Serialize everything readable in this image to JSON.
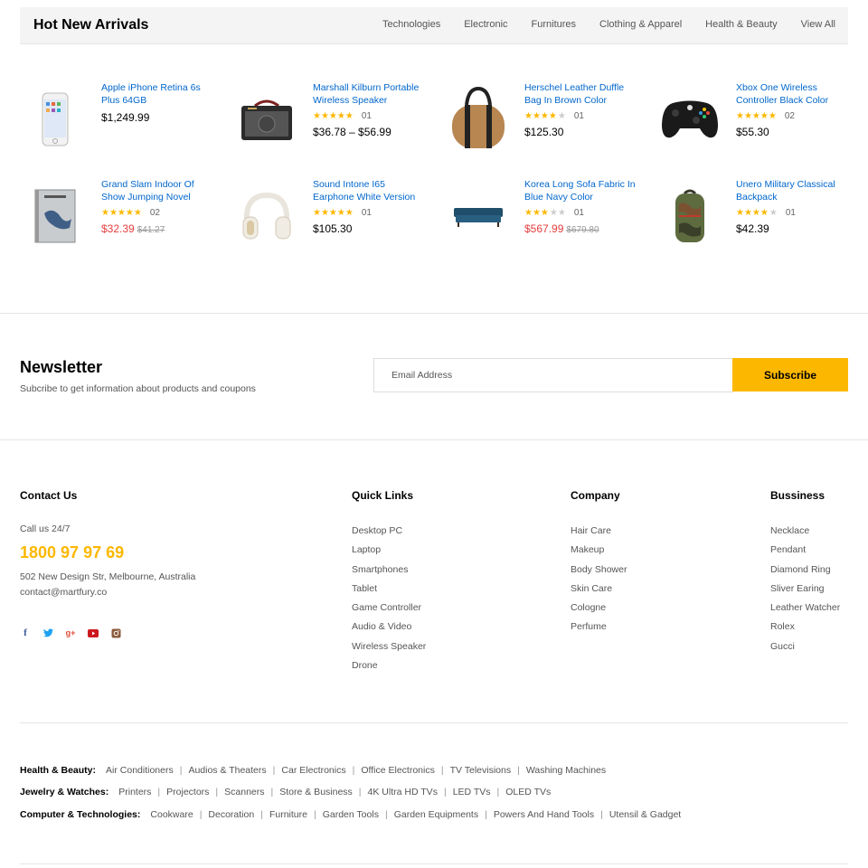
{
  "section": {
    "title": "Hot New Arrivals",
    "tabs": [
      "Technologies",
      "Electronic",
      "Furnitures",
      "Clothing & Apparel",
      "Health & Beauty",
      "View All"
    ]
  },
  "products": [
    {
      "name": "Apple iPhone Retina 6s Plus 64GB",
      "price": "$1,249.99",
      "rating": null,
      "reviews": null,
      "old_price": null,
      "sale": false,
      "image": "smartphone-image"
    },
    {
      "name": "Marshall Kilburn Portable Wireless Speaker",
      "price": "$36.78 – $56.99",
      "rating": 5,
      "reviews": "01",
      "old_price": null,
      "sale": false,
      "image": "speaker-image"
    },
    {
      "name": "Herschel Leather Duffle Bag In Brown Color",
      "price": "$125.30",
      "rating": 4,
      "reviews": "01",
      "old_price": null,
      "sale": false,
      "image": "duffle-bag-image"
    },
    {
      "name": "Xbox One Wireless Controller Black Color",
      "price": "$55.30",
      "rating": 4.5,
      "reviews": "02",
      "old_price": null,
      "sale": false,
      "image": "game-controller-image"
    },
    {
      "name": "Grand Slam Indoor Of Show Jumping Novel",
      "price": "$32.39",
      "rating": 5,
      "reviews": "02",
      "old_price": "$41.27",
      "sale": true,
      "image": "book-image"
    },
    {
      "name": "Sound Intone I65 Earphone White Version",
      "price": "$105.30",
      "rating": 5,
      "reviews": "01",
      "old_price": null,
      "sale": false,
      "image": "headphones-image"
    },
    {
      "name": "Korea Long Sofa Fabric In Blue Navy Color",
      "price": "$567.99",
      "rating": 3,
      "reviews": "01",
      "old_price": "$679.80",
      "sale": true,
      "image": "sofa-image"
    },
    {
      "name": "Unero Military Classical Backpack",
      "price": "$42.39",
      "rating": 4,
      "reviews": "01",
      "old_price": null,
      "sale": false,
      "image": "backpack-image"
    }
  ],
  "newsletter": {
    "title": "Newsletter",
    "subtitle": "Subcribe to get information about products and coupons",
    "placeholder": "Email Address",
    "button": "Subscribe"
  },
  "contact": {
    "title": "Contact Us",
    "call": "Call us 24/7",
    "phone": "1800 97 97 69",
    "address": "502 New Design Str, Melbourne, Australia",
    "email": "contact@martfury.co",
    "socials": [
      "facebook-icon",
      "twitter-icon",
      "google-plus-icon",
      "youtube-icon",
      "instagram-icon"
    ]
  },
  "columns": [
    {
      "title": "Quick Links",
      "items": [
        "Desktop PC",
        "Laptop",
        "Smartphones",
        "Tablet",
        "Game Controller",
        "Audio & Video",
        "Wireless Speaker",
        "Drone"
      ]
    },
    {
      "title": "Company",
      "items": [
        "Hair Care",
        "Makeup",
        "Body Shower",
        "Skin Care",
        "Cologne",
        "Perfume"
      ]
    },
    {
      "title": "Bussiness",
      "items": [
        "Necklace",
        "Pendant",
        "Diamond Ring",
        "Sliver Earing",
        "Leather Watcher",
        "Rolex",
        "Gucci"
      ]
    }
  ],
  "categories": [
    {
      "label": "Health & Beauty:",
      "links": [
        "Air Conditioners",
        "Audios & Theaters",
        "Car Electronics",
        "Office Electronics",
        "TV Televisions",
        "Washing Machines"
      ]
    },
    {
      "label": "Jewelry & Watches:",
      "links": [
        "Printers",
        "Projectors",
        "Scanners",
        "Store & Business",
        "4K Ultra HD TVs",
        "LED TVs",
        "OLED TVs"
      ]
    },
    {
      "label": "Computer & Technologies:",
      "links": [
        "Cookware",
        "Decoration",
        "Furniture",
        "Garden Tools",
        "Garden Equipments",
        "Powers And Hand Tools",
        "Utensil & Gadget"
      ]
    }
  ],
  "colors": {
    "accent": "#fcb800",
    "link": "#0066cc",
    "sale": "#e53e3e"
  }
}
